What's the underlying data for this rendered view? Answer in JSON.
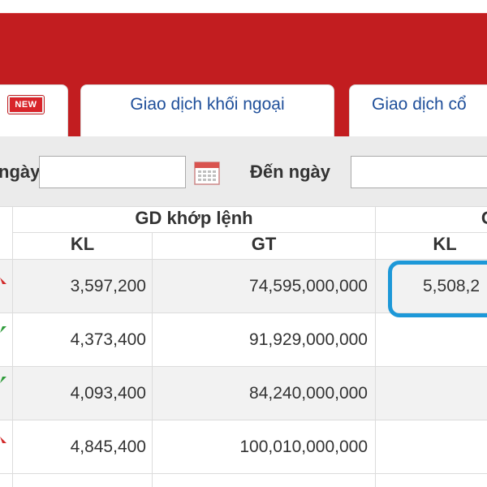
{
  "tabs": [
    {
      "label": "",
      "badge": "NEW"
    },
    {
      "label": "Giao dịch khối ngoại"
    },
    {
      "label": "Giao dịch cổ"
    }
  ],
  "filter": {
    "from_label": "ngày",
    "to_label": "Đến ngày",
    "from_value": "",
    "to_value": ""
  },
  "table": {
    "group_header": "GD khớp lệnh",
    "group_header_2": "G",
    "columns": [
      "KL",
      "GT",
      "KL"
    ],
    "rows": [
      {
        "kl": "3,597,200",
        "gt": "74,595,000,000",
        "kl2": "5,508,2",
        "trend": "down"
      },
      {
        "kl": "4,373,400",
        "gt": "91,929,000,000",
        "kl2": "",
        "trend": "up"
      },
      {
        "kl": "4,093,400",
        "gt": "84,240,000,000",
        "kl2": "",
        "trend": "up"
      },
      {
        "kl": "4,845,400",
        "gt": "100,010,000,000",
        "kl2": "",
        "trend": "down"
      }
    ]
  },
  "colors": {
    "brand_red": "#c21d20",
    "tab_text": "#1f4f9a",
    "annotation": "#1d98d8",
    "up": "#2e9b3a",
    "down": "#d22a2a"
  }
}
